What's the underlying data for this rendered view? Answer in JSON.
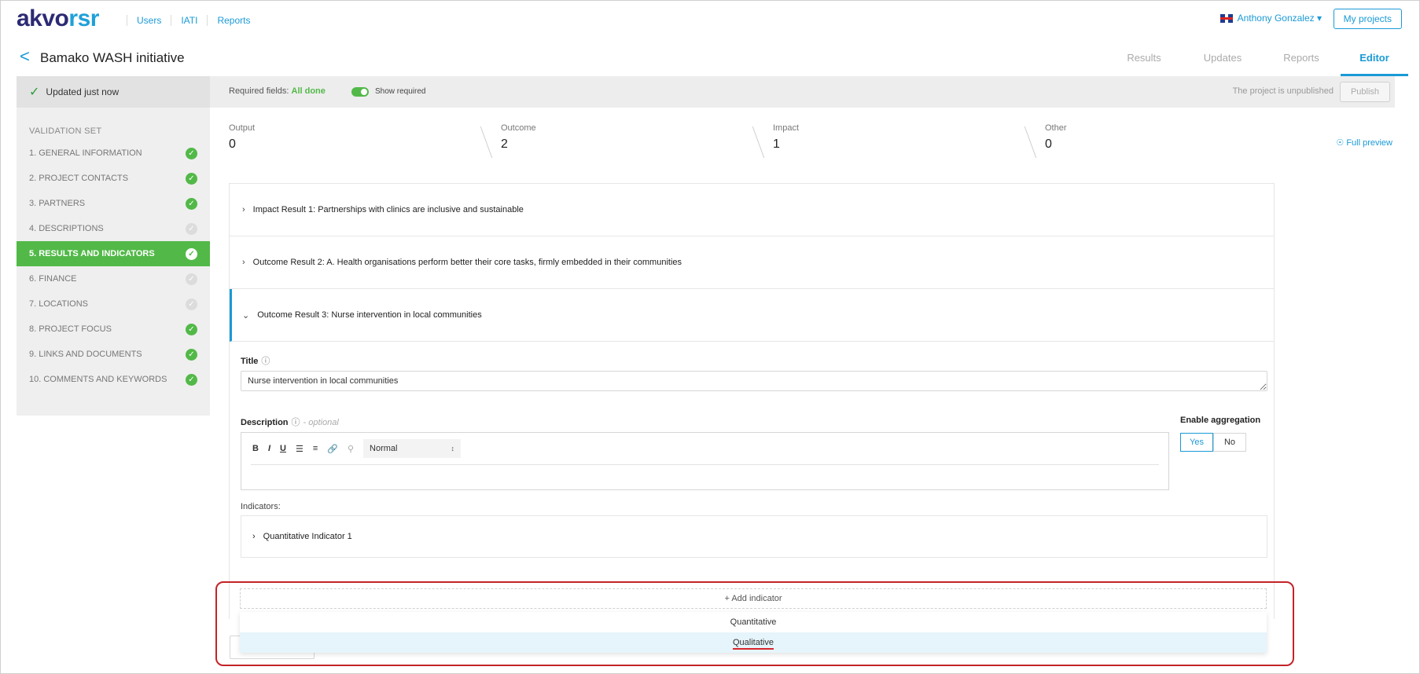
{
  "app": {
    "logo_a": "akvo",
    "logo_b": "rsr"
  },
  "topnav": [
    "Users",
    "IATI",
    "Reports"
  ],
  "user": {
    "name": "Anthony Gonzalez ▾",
    "my_projects": "My projects"
  },
  "project": {
    "back": "<",
    "title": "Bamako WASH initiative"
  },
  "tabs": [
    {
      "label": "Results",
      "active": false
    },
    {
      "label": "Updates",
      "active": false
    },
    {
      "label": "Reports",
      "active": false
    },
    {
      "label": "Editor",
      "active": true
    }
  ],
  "status": {
    "updated": "Updated just now",
    "required_prefix": "Required fields: ",
    "required_value": "All done",
    "show_required": "Show required",
    "unpublished": "The project is unpublished",
    "publish": "Publish"
  },
  "sidebar": {
    "heading": "VALIDATION SET",
    "items": [
      {
        "label": "1. GENERAL INFORMATION",
        "done": true
      },
      {
        "label": "2. PROJECT CONTACTS",
        "done": true
      },
      {
        "label": "3. PARTNERS",
        "done": true
      },
      {
        "label": "4. DESCRIPTIONS",
        "done": false
      },
      {
        "label": "5. RESULTS AND INDICATORS",
        "done": true,
        "active": true
      },
      {
        "label": "6. FINANCE",
        "done": false
      },
      {
        "label": "7. LOCATIONS",
        "done": false
      },
      {
        "label": "8. PROJECT FOCUS",
        "done": true
      },
      {
        "label": "9. LINKS AND DOCUMENTS",
        "done": true
      },
      {
        "label": "10. COMMENTS AND KEYWORDS",
        "done": true
      }
    ]
  },
  "counts": [
    {
      "label": "Output",
      "value": "0"
    },
    {
      "label": "Outcome",
      "value": "2"
    },
    {
      "label": "Impact",
      "value": "1"
    },
    {
      "label": "Other",
      "value": "0"
    }
  ],
  "full_preview": "Full preview",
  "results": [
    {
      "label": "Impact Result 1: Partnerships with clinics are inclusive and sustainable"
    },
    {
      "label": "Outcome Result 2: A. Health organisations perform better their core tasks, firmly embedded in their communities"
    },
    {
      "label": "Outcome Result 3: Nurse intervention in local communities"
    }
  ],
  "form": {
    "title_label": "Title",
    "title_value": "Nurse intervention in local communities",
    "description_label": "Description",
    "optional": "- optional",
    "format": "Normal",
    "aggregation_label": "Enable aggregation",
    "yes": "Yes",
    "no": "No",
    "indicators_label": "Indicators:",
    "indicator_1": "Quantitative Indicator 1",
    "add_indicator": "+  Add indicator",
    "menu": [
      "Quantitative",
      "Qualitative"
    ]
  }
}
